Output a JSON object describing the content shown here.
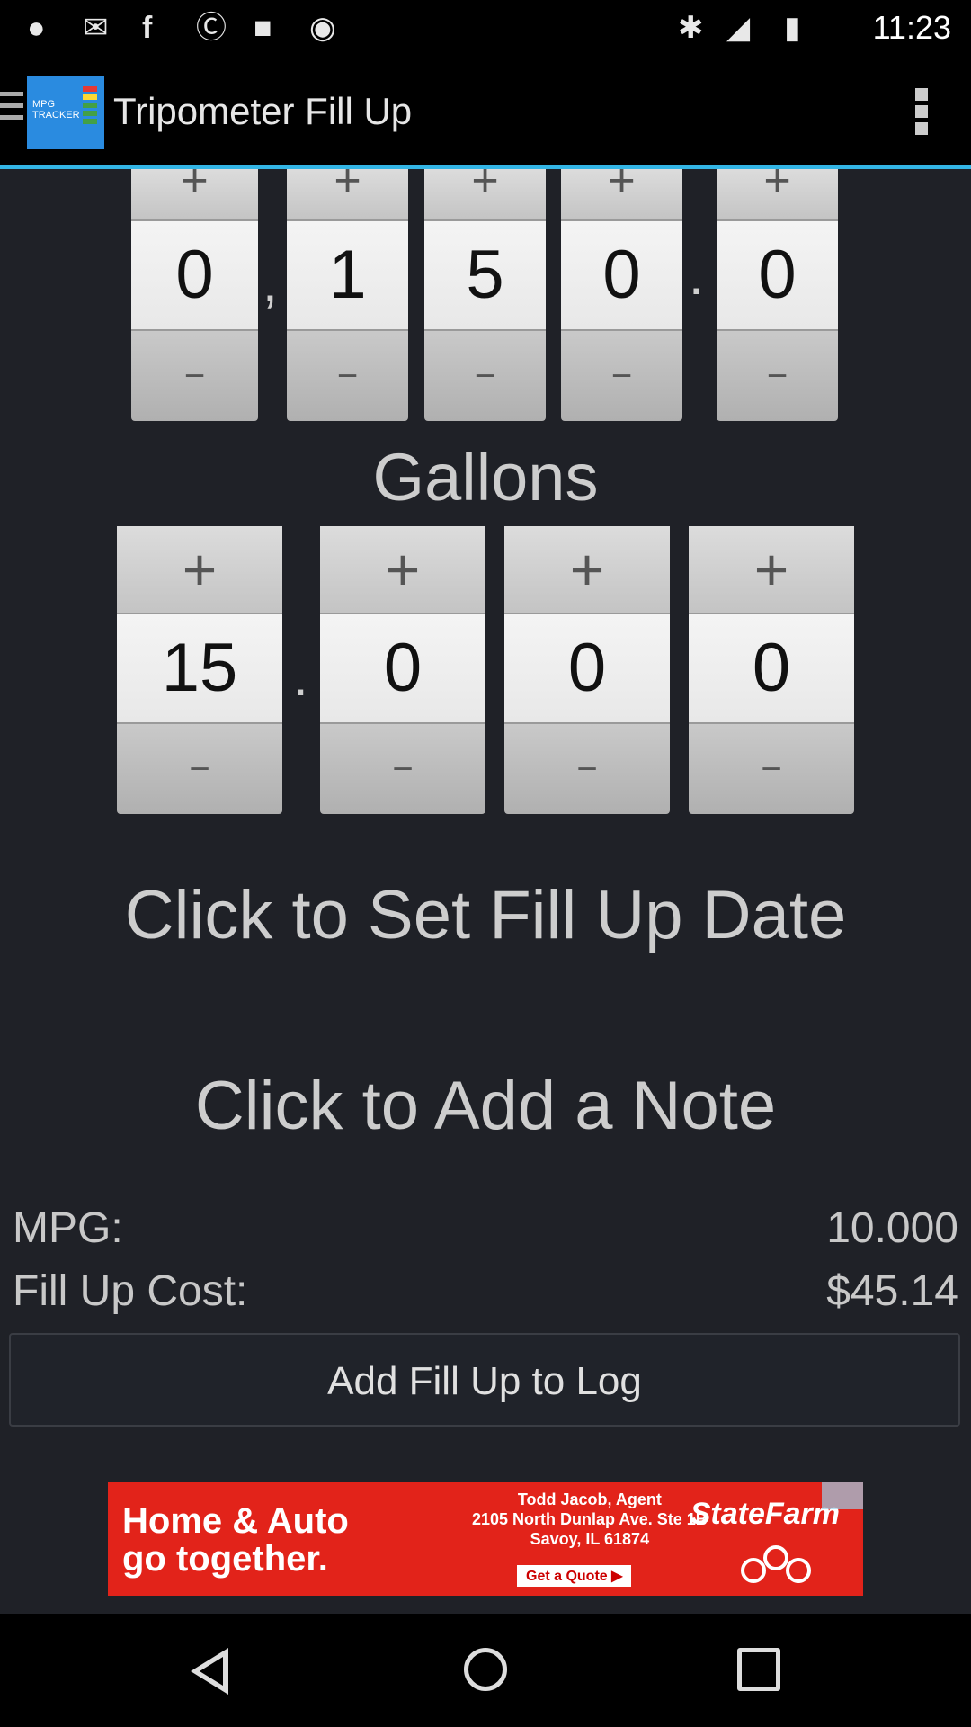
{
  "status_bar": {
    "time": "11:23",
    "icons": [
      "notification-icon",
      "mail-icon",
      "facebook-icon",
      "sync-icon",
      "lock-icon",
      "android-icon",
      "bluetooth-icon",
      "signal-icon",
      "battery-icon"
    ]
  },
  "action_bar": {
    "title": "Tripometer Fill Up",
    "logo_text": "MPG\nTRACKER"
  },
  "odometer": {
    "digits": [
      "0",
      "1",
      "5",
      "0",
      "0"
    ],
    "comma": ",",
    "decimal": "."
  },
  "gallons": {
    "label": "Gallons",
    "digits": [
      "15",
      "0",
      "0",
      "0"
    ],
    "decimal": "."
  },
  "wheel_controls": {
    "plus": "+",
    "minus": "−"
  },
  "date_prompt": "Click to Set Fill Up Date",
  "note_prompt": "Click to Add a Note",
  "stats": {
    "mpg_label": "MPG:",
    "mpg_value": "10.000",
    "cost_label": "Fill Up Cost:",
    "cost_value": "$45.14"
  },
  "add_button": "Add Fill Up to Log",
  "ad": {
    "headline_1": "Home & Auto",
    "headline_2": "go together.",
    "agent_line_1": "Todd Jacob, Agent",
    "agent_line_2": "2105 North Dunlap Ave. Ste 1B",
    "agent_line_3": "Savoy, IL 61874",
    "cta": "Get a Quote ▶",
    "brand": "StateFarm"
  },
  "colors": {
    "accent": "#33b5e5",
    "background": "#1f2127",
    "ad_red": "#e2231a"
  }
}
